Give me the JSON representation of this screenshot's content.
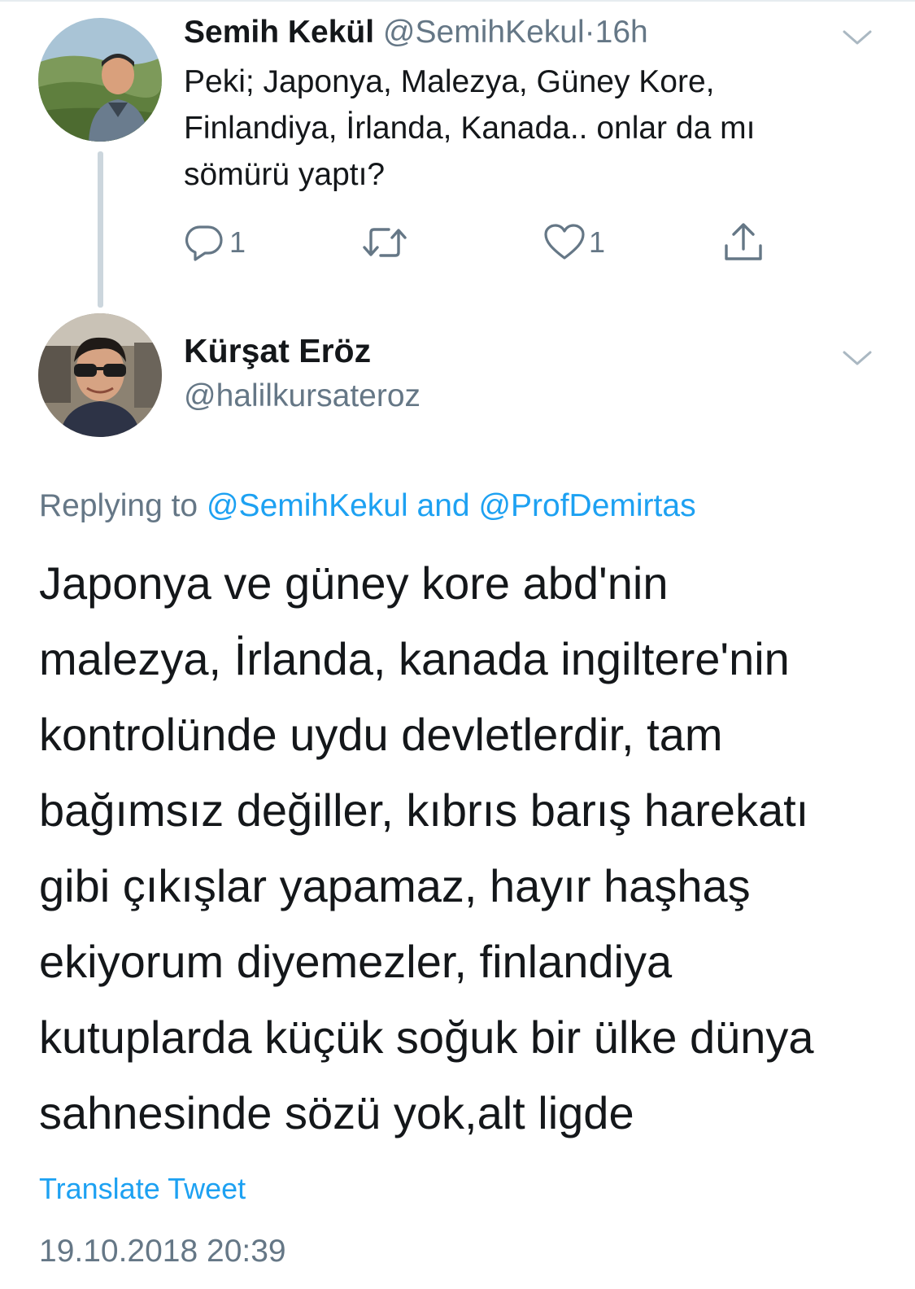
{
  "tweet1": {
    "author_name": "Semih Kekül",
    "handle": "@SemihKekul",
    "separator": "·",
    "time": "16h",
    "text_lines": [
      "Peki; Japonya, Malezya, Güney Kore,",
      "Finlandiya, İrlanda, Kanada.. onlar da mı",
      "sömürü yaptı?"
    ],
    "actions": {
      "reply_icon": "reply-icon",
      "reply_count": "1",
      "retweet_icon": "retweet-icon",
      "like_icon": "heart-icon",
      "like_count": "1",
      "share_icon": "share-icon"
    }
  },
  "tweet2": {
    "author_name": "Kürşat Eröz",
    "handle": "@halilkursateroz",
    "replying_prefix": "Replying to",
    "replying_user1": "@SemihKekul",
    "replying_and": "and",
    "replying_user2": "@ProfDemirtas",
    "text_lines": [
      "Japonya ve güney kore abd'nin",
      "malezya, İrlanda, kanada ingiltere'nin",
      "kontrolünde uydu devletlerdir, tam",
      "bağımsız değiller, kıbrıs barış harekatı",
      "gibi çıkışlar yapamaz, hayır haşhaş",
      "ekiyorum diyemezler, finlandiya",
      "kutuplarda küçük soğuk bir ülke dünya",
      "sahnesinde sözü yok,alt ligde"
    ],
    "translate_label": "Translate Tweet",
    "timestamp": "19.10.2018 20:39"
  },
  "colors": {
    "text": "#14171a",
    "secondary": "#657786",
    "link": "#1da1f2",
    "thread_line": "#ccd6dd"
  }
}
